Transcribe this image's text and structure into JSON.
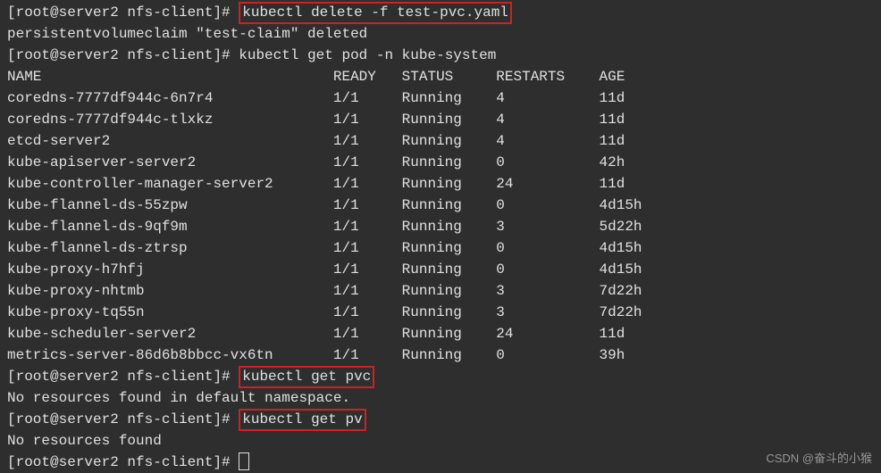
{
  "prompt1_prefix": "[root@server2 nfs-client]# ",
  "cmd1": "kubectl delete -f test-pvc.yaml",
  "output1": "persistentvolumeclaim \"test-claim\" deleted",
  "prompt2_prefix": "[root@server2 nfs-client]# ",
  "cmd2": "kubectl get pod -n kube-system",
  "headers": {
    "name": "NAME",
    "ready": "READY",
    "status": "STATUS",
    "restarts": "RESTARTS",
    "age": "AGE"
  },
  "pods": [
    {
      "name": "coredns-7777df944c-6n7r4",
      "ready": "1/1",
      "status": "Running",
      "restarts": "4",
      "age": "11d"
    },
    {
      "name": "coredns-7777df944c-tlxkz",
      "ready": "1/1",
      "status": "Running",
      "restarts": "4",
      "age": "11d"
    },
    {
      "name": "etcd-server2",
      "ready": "1/1",
      "status": "Running",
      "restarts": "4",
      "age": "11d"
    },
    {
      "name": "kube-apiserver-server2",
      "ready": "1/1",
      "status": "Running",
      "restarts": "0",
      "age": "42h"
    },
    {
      "name": "kube-controller-manager-server2",
      "ready": "1/1",
      "status": "Running",
      "restarts": "24",
      "age": "11d"
    },
    {
      "name": "kube-flannel-ds-55zpw",
      "ready": "1/1",
      "status": "Running",
      "restarts": "0",
      "age": "4d15h"
    },
    {
      "name": "kube-flannel-ds-9qf9m",
      "ready": "1/1",
      "status": "Running",
      "restarts": "3",
      "age": "5d22h"
    },
    {
      "name": "kube-flannel-ds-ztrsp",
      "ready": "1/1",
      "status": "Running",
      "restarts": "0",
      "age": "4d15h"
    },
    {
      "name": "kube-proxy-h7hfj",
      "ready": "1/1",
      "status": "Running",
      "restarts": "0",
      "age": "4d15h"
    },
    {
      "name": "kube-proxy-nhtmb",
      "ready": "1/1",
      "status": "Running",
      "restarts": "3",
      "age": "7d22h"
    },
    {
      "name": "kube-proxy-tq55n",
      "ready": "1/1",
      "status": "Running",
      "restarts": "3",
      "age": "7d22h"
    },
    {
      "name": "kube-scheduler-server2",
      "ready": "1/1",
      "status": "Running",
      "restarts": "24",
      "age": "11d"
    },
    {
      "name": "metrics-server-86d6b8bbcc-vx6tn",
      "ready": "1/1",
      "status": "Running",
      "restarts": "0",
      "age": "39h"
    }
  ],
  "prompt3_prefix": "[root@server2 nfs-client]# ",
  "cmd3": "kubectl get pvc",
  "output3": "No resources found in default namespace.",
  "prompt4_prefix": "[root@server2 nfs-client]# ",
  "cmd4": "kubectl get pv",
  "output4": "No resources found",
  "prompt5_prefix": "[root@server2 nfs-client]# ",
  "watermark": "CSDN @奋斗的小猴"
}
